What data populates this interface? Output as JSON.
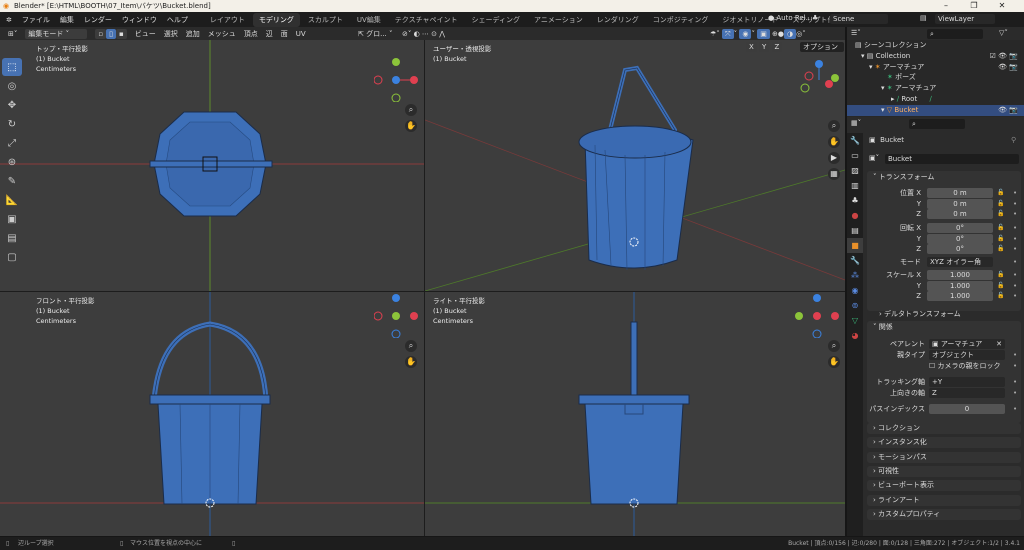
{
  "window": {
    "title": "Blender* [E:\\HTML\\BOOTH\\07_Item\\バケツ\\Bucket.blend]",
    "minimize": "–",
    "maximize": "❐",
    "close": "✕"
  },
  "menu": [
    "ファイル",
    "編集",
    "レンダー",
    "ウィンドウ",
    "ヘルプ"
  ],
  "workspaces": [
    "レイアウト",
    "モデリング",
    "スカルプト",
    "UV編集",
    "テクスチャペイント",
    "シェーディング",
    "アニメーション",
    "レンダリング",
    "コンポジティング",
    "ジオメトリノード",
    "スクリプト作成",
    "+"
  ],
  "active_workspace": 1,
  "topright": {
    "auto": "Auto Rel...",
    "scene": "Scene",
    "viewlayer": "ViewLayer"
  },
  "header": {
    "mode": "編集モード",
    "menus": [
      "ビュー",
      "選択",
      "追加",
      "メッシュ",
      "頂点",
      "辺",
      "面",
      "UV"
    ],
    "orientation": "グロ...",
    "axes": [
      "X",
      "Y",
      "Z"
    ],
    "options": "オプション"
  },
  "viewports": [
    {
      "name": "トップ・平行投影",
      "object": "(1) Bucket",
      "units": "Centimeters"
    },
    {
      "name": "ユーザー・透視投影",
      "object": "(1) Bucket",
      "units": ""
    },
    {
      "name": "フロント・平行投影",
      "object": "(1) Bucket",
      "units": "Centimeters"
    },
    {
      "name": "ライト・平行投影",
      "object": "(1) Bucket",
      "units": "Centimeters"
    }
  ],
  "outliner": {
    "items": [
      {
        "label": "シーンコレクション",
        "depth": 0
      },
      {
        "label": "Collection",
        "depth": 1
      },
      {
        "label": "アーマチュア",
        "depth": 2
      },
      {
        "label": "ポーズ",
        "depth": 3
      },
      {
        "label": "アーマチュア",
        "depth": 3
      },
      {
        "label": "Root",
        "depth": 4
      },
      {
        "label": "Bucket",
        "depth": 2,
        "selected": true
      }
    ]
  },
  "properties": {
    "object_name": "Bucket",
    "datablock": "Bucket",
    "transform": {
      "title": "トランスフォーム",
      "location": {
        "label": "位置 X",
        "x": "0 m",
        "y": "0 m",
        "z": "0 m"
      },
      "rotation": {
        "label": "回転 X",
        "x": "0°",
        "y": "0°",
        "z": "0°"
      },
      "mode": {
        "label": "モード",
        "value": "XYZ オイラー角"
      },
      "scale": {
        "label": "スケール X",
        "x": "1.000",
        "y": "1.000",
        "z": "1.000"
      },
      "axis_y": "Y",
      "axis_z": "Z"
    },
    "delta": "デルタトランスフォーム",
    "relations": {
      "title": "関係",
      "parent_label": "ペアレント",
      "parent": "アーマチュア",
      "parent_type_label": "親タイプ",
      "parent_type": "オブジェクト",
      "lock_camera": "カメラの親をロック",
      "track_label": "トラッキング軸",
      "track": "+Y",
      "up_label": "上向きの軸",
      "up": "Z",
      "pass_label": "パスインデックス",
      "pass": "0"
    },
    "collapsed": [
      "コレクション",
      "インスタンス化",
      "モーションパス",
      "可視性",
      "ビューポート表示",
      "ラインアート",
      "カスタムプロパティ"
    ]
  },
  "status": {
    "left1": "辺ループ選択",
    "left2": "マウス位置を視点の中心に",
    "right": "Bucket | 頂点:0/156 | 辺:0/280 | 面:0/128 | 三角面:272 | オブジェクト:1/2 | 3.4.1"
  },
  "colors": {
    "accent": "#4772b3",
    "mesh": "#3d6fb8",
    "viewport": "#3d3d3d"
  }
}
